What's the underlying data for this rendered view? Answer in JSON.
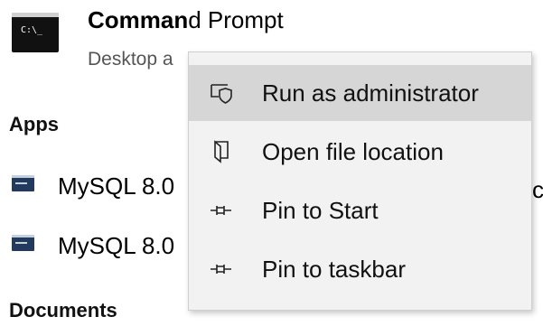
{
  "top_result": {
    "title_bold": "Comman",
    "title_rest": "d Prompt",
    "subtitle": "Desktop a",
    "icon": "command-prompt-icon",
    "icon_text": "C:\\_"
  },
  "sections": {
    "apps": "Apps",
    "documents": "Documents"
  },
  "apps": [
    {
      "label": "MySQL 8.0",
      "icon": "mysql-console-icon"
    },
    {
      "label": "MySQL 8.0",
      "icon": "mysql-console-icon"
    }
  ],
  "trailing_fragment": "c",
  "context_menu": {
    "items": [
      {
        "label": "Run as administrator",
        "icon": "shield-run-icon",
        "highlighted": true
      },
      {
        "label": "Open file location",
        "icon": "folder-open-icon",
        "highlighted": false
      },
      {
        "label": "Pin to Start",
        "icon": "pin-icon",
        "highlighted": false
      },
      {
        "label": "Pin to taskbar",
        "icon": "pin-icon",
        "highlighted": false
      }
    ]
  },
  "colors": {
    "menu_background": "#f2f2f2",
    "menu_highlight": "#d6d6d6",
    "subtitle_text": "#555555"
  }
}
